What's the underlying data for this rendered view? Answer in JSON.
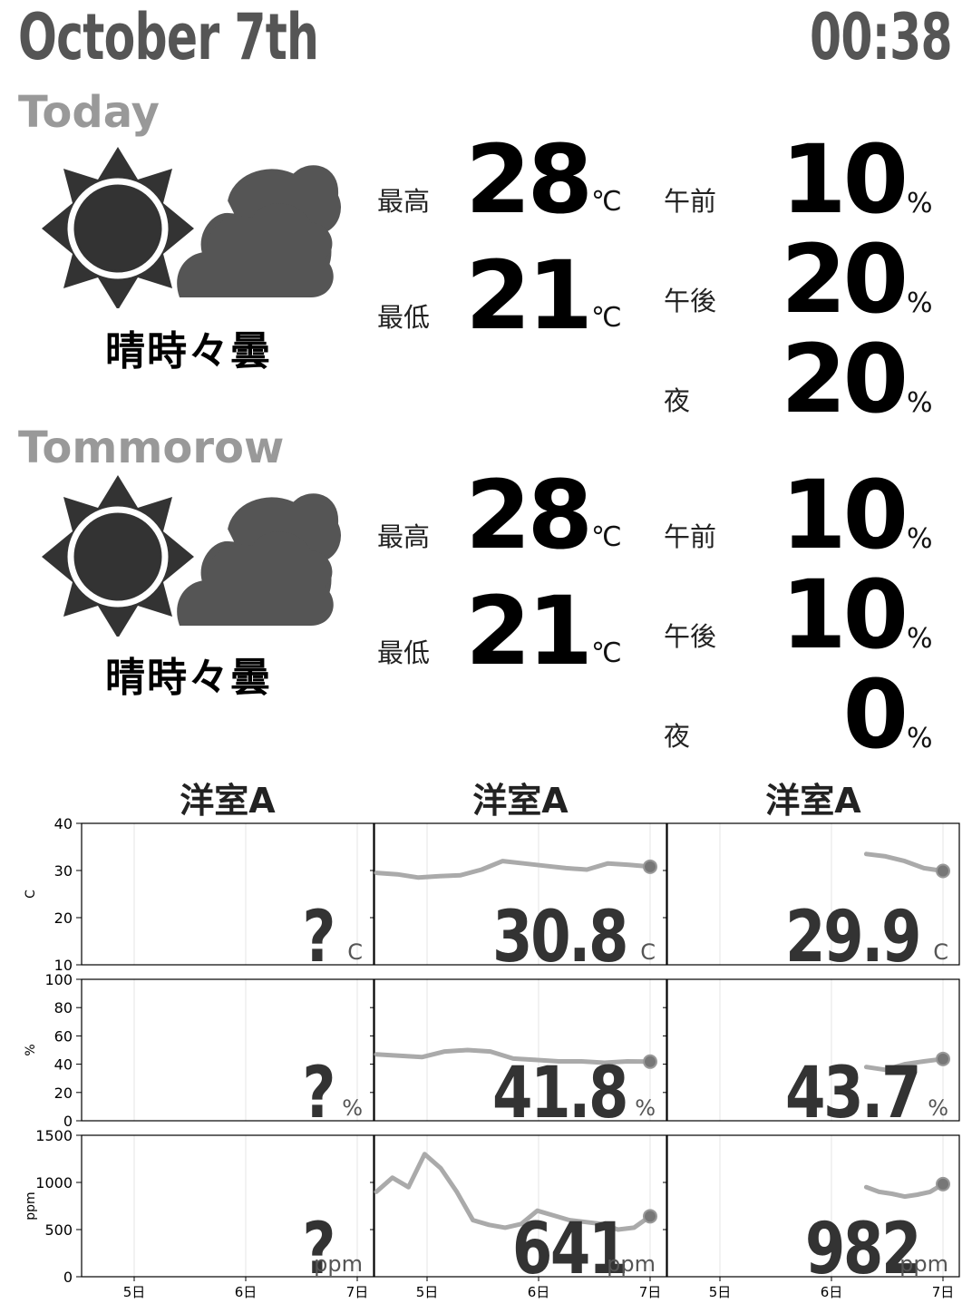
{
  "header": {
    "date": "October 7th",
    "time": "00:38"
  },
  "today": {
    "label": "Today",
    "weather_text": "晴時々曇",
    "icon": "sun-cloud-icon",
    "temps": [
      {
        "label": "最高",
        "value": "28",
        "unit": "℃"
      },
      {
        "label": "最低",
        "value": "21",
        "unit": "℃"
      }
    ],
    "rain": [
      {
        "label": "午前",
        "value": "10",
        "unit": "%"
      },
      {
        "label": "午後",
        "value": "20",
        "unit": "%"
      },
      {
        "label": "夜",
        "value": "20",
        "unit": "%"
      }
    ]
  },
  "tomorrow": {
    "label": "Tommorow",
    "weather_text": "晴時々曇",
    "icon": "sun-cloud-icon",
    "temps": [
      {
        "label": "最高",
        "value": "28",
        "unit": "℃"
      },
      {
        "label": "最低",
        "value": "21",
        "unit": "℃"
      }
    ],
    "rain": [
      {
        "label": "午前",
        "value": "10",
        "unit": "%"
      },
      {
        "label": "午後",
        "value": "10",
        "unit": "%"
      },
      {
        "label": "夜",
        "value": "0",
        "unit": "%"
      }
    ]
  },
  "sensors": {
    "titles": [
      "洋室A",
      "洋室A",
      "洋室A"
    ],
    "x_ticks": [
      "5日",
      "6日",
      "7日"
    ],
    "rows": [
      {
        "ylabel": "C",
        "yticks": [
          "40",
          "30",
          "20",
          "10"
        ],
        "ylim": [
          10,
          40
        ],
        "unit": "C",
        "values": [
          "?",
          "30.8",
          "29.9"
        ]
      },
      {
        "ylabel": "%",
        "yticks": [
          "100",
          "80",
          "60",
          "40",
          "20",
          "0"
        ],
        "ylim": [
          0,
          100
        ],
        "unit": "%",
        "values": [
          "?",
          "41.8",
          "43.7"
        ]
      },
      {
        "ylabel": "ppm",
        "yticks": [
          "1500",
          "1000",
          "500",
          "0"
        ],
        "ylim": [
          0,
          1500
        ],
        "unit": "ppm",
        "values": [
          "?",
          "641",
          "982"
        ]
      }
    ]
  },
  "chart_data": [
    {
      "type": "line",
      "title": "洋室A",
      "ylabel": "C",
      "ylim": [
        10,
        40
      ],
      "x": [
        "5日",
        "6日",
        "7日"
      ],
      "series": [
        {
          "values": []
        },
        {
          "values": [
            29.5,
            29.2,
            28.5,
            28.8,
            29.0,
            30.2,
            32.0,
            31.5,
            31.0,
            30.5,
            30.2,
            31.5,
            31.2,
            30.8
          ]
        },
        {
          "values": [
            33.5,
            33.0,
            32.0,
            30.5,
            29.9
          ]
        }
      ]
    },
    {
      "type": "line",
      "title": "洋室A",
      "ylabel": "%",
      "ylim": [
        0,
        100
      ],
      "x": [
        "5日",
        "6日",
        "7日"
      ],
      "series": [
        {
          "values": []
        },
        {
          "values": [
            47,
            46,
            45,
            49,
            50,
            49,
            44,
            43,
            42,
            42,
            41,
            42,
            41.8
          ]
        },
        {
          "values": [
            38,
            36,
            40,
            42,
            43.7
          ]
        }
      ]
    },
    {
      "type": "line",
      "title": "洋室A",
      "ylabel": "ppm",
      "ylim": [
        0,
        1500
      ],
      "x": [
        "5日",
        "6日",
        "7日"
      ],
      "series": [
        {
          "values": []
        },
        {
          "values": [
            900,
            1050,
            950,
            1300,
            1150,
            900,
            600,
            550,
            520,
            560,
            700,
            650,
            600,
            580,
            560,
            500,
            520,
            641
          ]
        },
        {
          "values": [
            950,
            900,
            880,
            850,
            870,
            900,
            982
          ]
        }
      ]
    }
  ],
  "colors": {
    "header": "#555555",
    "section": "#999999",
    "line": "#aaaaaa",
    "endpoint": "#777777",
    "big_value": "#333333"
  }
}
